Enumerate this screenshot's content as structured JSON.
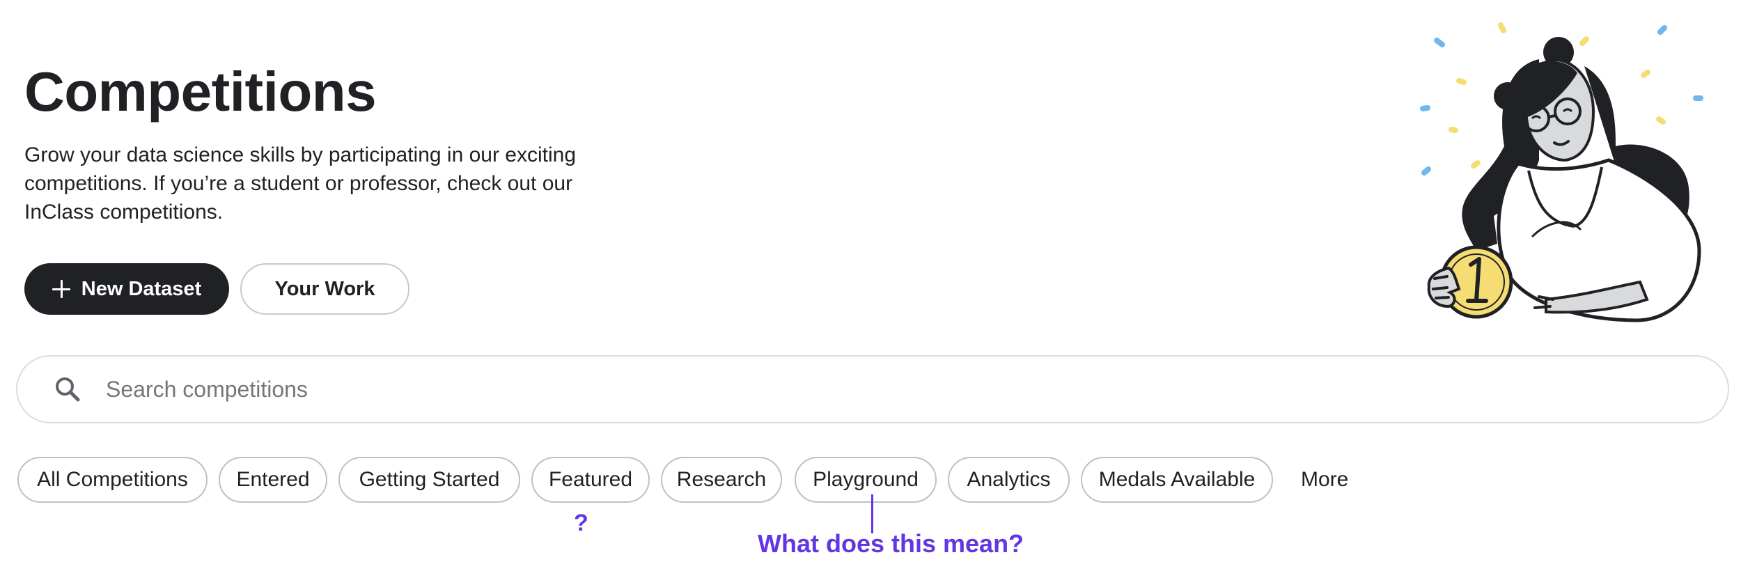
{
  "header": {
    "title": "Competitions",
    "description": "Grow your data science skills by participating in our exciting competitions. If you’re a student or professor, check out our InClass competitions."
  },
  "actions": {
    "new_dataset_label": "New Dataset",
    "new_dataset_icon": "plus-icon",
    "your_work_label": "Your Work"
  },
  "search": {
    "icon": "search-icon",
    "placeholder": "Search competitions",
    "value": ""
  },
  "filters": {
    "chips": [
      "All Competitions",
      "Entered",
      "Getting Started",
      "Featured",
      "Research",
      "Playground",
      "Analytics",
      "Medals Available"
    ],
    "more_label": "More"
  },
  "annotations": {
    "question_mark": "?",
    "callout": "What does this mean?",
    "color": "#6236e3"
  },
  "colors": {
    "primary_dark": "#202124",
    "border": "#bdc1c6",
    "coin_yellow": "#f5dd74",
    "confetti_blue": "#6fb7ec",
    "confetti_yellow": "#f5dd74"
  }
}
